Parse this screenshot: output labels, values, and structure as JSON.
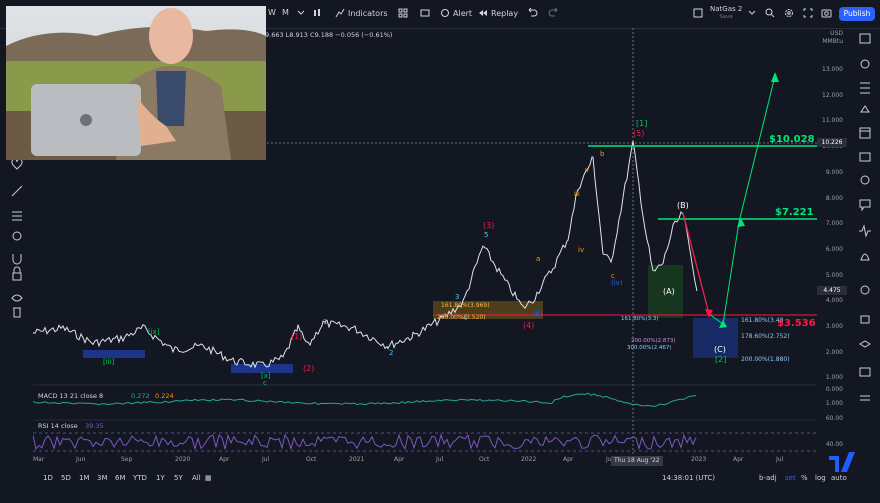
{
  "toolbar": {
    "interval_w": "W",
    "interval_m": "M",
    "indicators": "Indicators",
    "alert": "Alert",
    "replay": "Replay",
    "layout_name": "NatGas 2",
    "layout_status": "Save",
    "publish": "Publish"
  },
  "legend": {
    "ohlc": "9.663  L8.913  C9.188  −0.056 (−0.61%)",
    "macd_title": "MACD 13 21 close 8",
    "macd_v1": "0.272",
    "macd_v2": "0.224",
    "rsi_title": "RSI 14 close",
    "rsi_v": "39.35"
  },
  "price_axis": {
    "currency": "USD",
    "unit": "MMBtu",
    "ticks": [
      "13.000",
      "12.000",
      "11.000",
      "10.000",
      "9.000",
      "8.000",
      "7.000",
      "6.000",
      "5.000",
      "4.000",
      "3.000",
      "2.000",
      "1.000"
    ],
    "last_price": "10.226",
    "current_price": "4.475",
    "macd_ticks": [
      "0.000",
      "1.000"
    ],
    "rsi_ticks": [
      "60.00",
      "40.00"
    ]
  },
  "time_axis": {
    "labels": [
      "Mar",
      "Jun",
      "Sep",
      "2020",
      "Apr",
      "Jul",
      "Oct",
      "2021",
      "Apr",
      "Jul",
      "Oct",
      "2022",
      "Apr",
      "Jul",
      "Oct",
      "2023",
      "Apr",
      "Jul"
    ],
    "crosshair_date": "Thu 18 Aug '22"
  },
  "targets": {
    "t1": "$10.028",
    "t2": "$7.221",
    "t3": "$3.536"
  },
  "fib": {
    "f1": "161.80%(3.43",
    "f2": "178.60%(2.752)",
    "f3": "200.00%(1.880)",
    "lower1": "161.80%(3.3)",
    "lower2": "200.00%(2.873)",
    "lower3": "300.00%(2.467)",
    "left1": "161.80%(3.969)",
    "left2": "200.00%(3.520)"
  },
  "waves": {
    "w1b": "[1]",
    "w5": "(5)",
    "w3": "(3)",
    "w4": "(4)",
    "w2": "(2)",
    "w1": "(1)",
    "wA": "(A)",
    "wB": "(B)",
    "wC": "(C)",
    "w2b": "[2]",
    "iii_b": "[iii]",
    "ix_b": "[ix]",
    "x_b": "[x]",
    "c_b": "c",
    "i1": "1",
    "i2": "2",
    "i3": "3",
    "i4": "4",
    "i5": "5",
    "ia": "a",
    "ib": "b",
    "ic": "c",
    "iv": "(iv)",
    "ii": "(ii)",
    "ivs": "iv",
    "v": "v",
    "iii": "iii"
  },
  "bottom": {
    "ranges": [
      "1D",
      "5D",
      "1M",
      "3M",
      "6M",
      "YTD",
      "1Y",
      "5Y",
      "All"
    ],
    "clock": "14:38:01 (UTC)",
    "badj": "b-adj",
    "set": "set",
    "pct": "%",
    "log": "log",
    "auto": "auto"
  },
  "colors": {
    "accent": "#2962ff",
    "green": "#00e676",
    "red": "#ff1744",
    "bg": "#131722"
  },
  "webcam": {
    "description_icon": "presenter-video"
  }
}
